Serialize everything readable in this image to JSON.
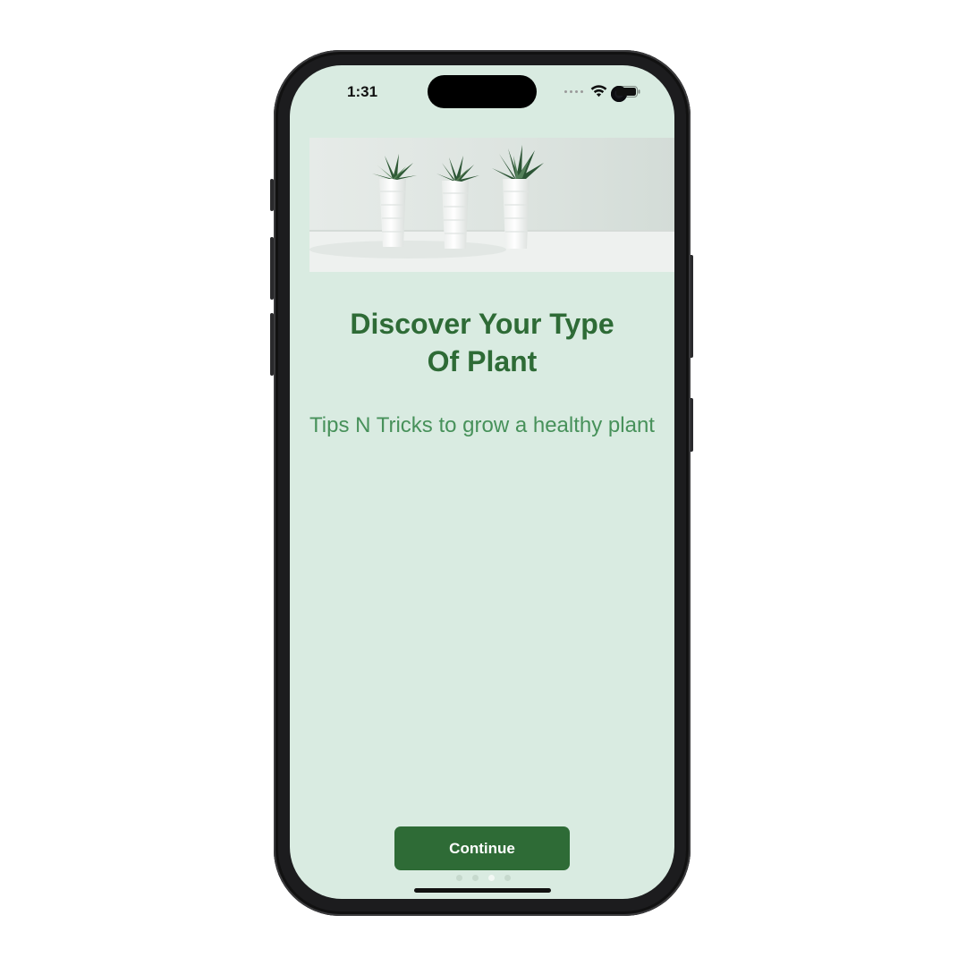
{
  "status_bar": {
    "time": "1:31",
    "icons": [
      "signal-dots-icon",
      "wifi-icon",
      "battery-icon"
    ]
  },
  "onboarding": {
    "hero_icon": "potted-plants-image",
    "title_line1": "Discover Your Type",
    "title_line2": "Of Plant",
    "subtitle": "Tips N Tricks to grow a healthy plant",
    "continue_label": "Continue",
    "page_count": 4,
    "active_page_index": 2
  },
  "colors": {
    "background": "#d9ebe1",
    "primary_green": "#2e6b36",
    "subtitle_green": "#47915a"
  }
}
